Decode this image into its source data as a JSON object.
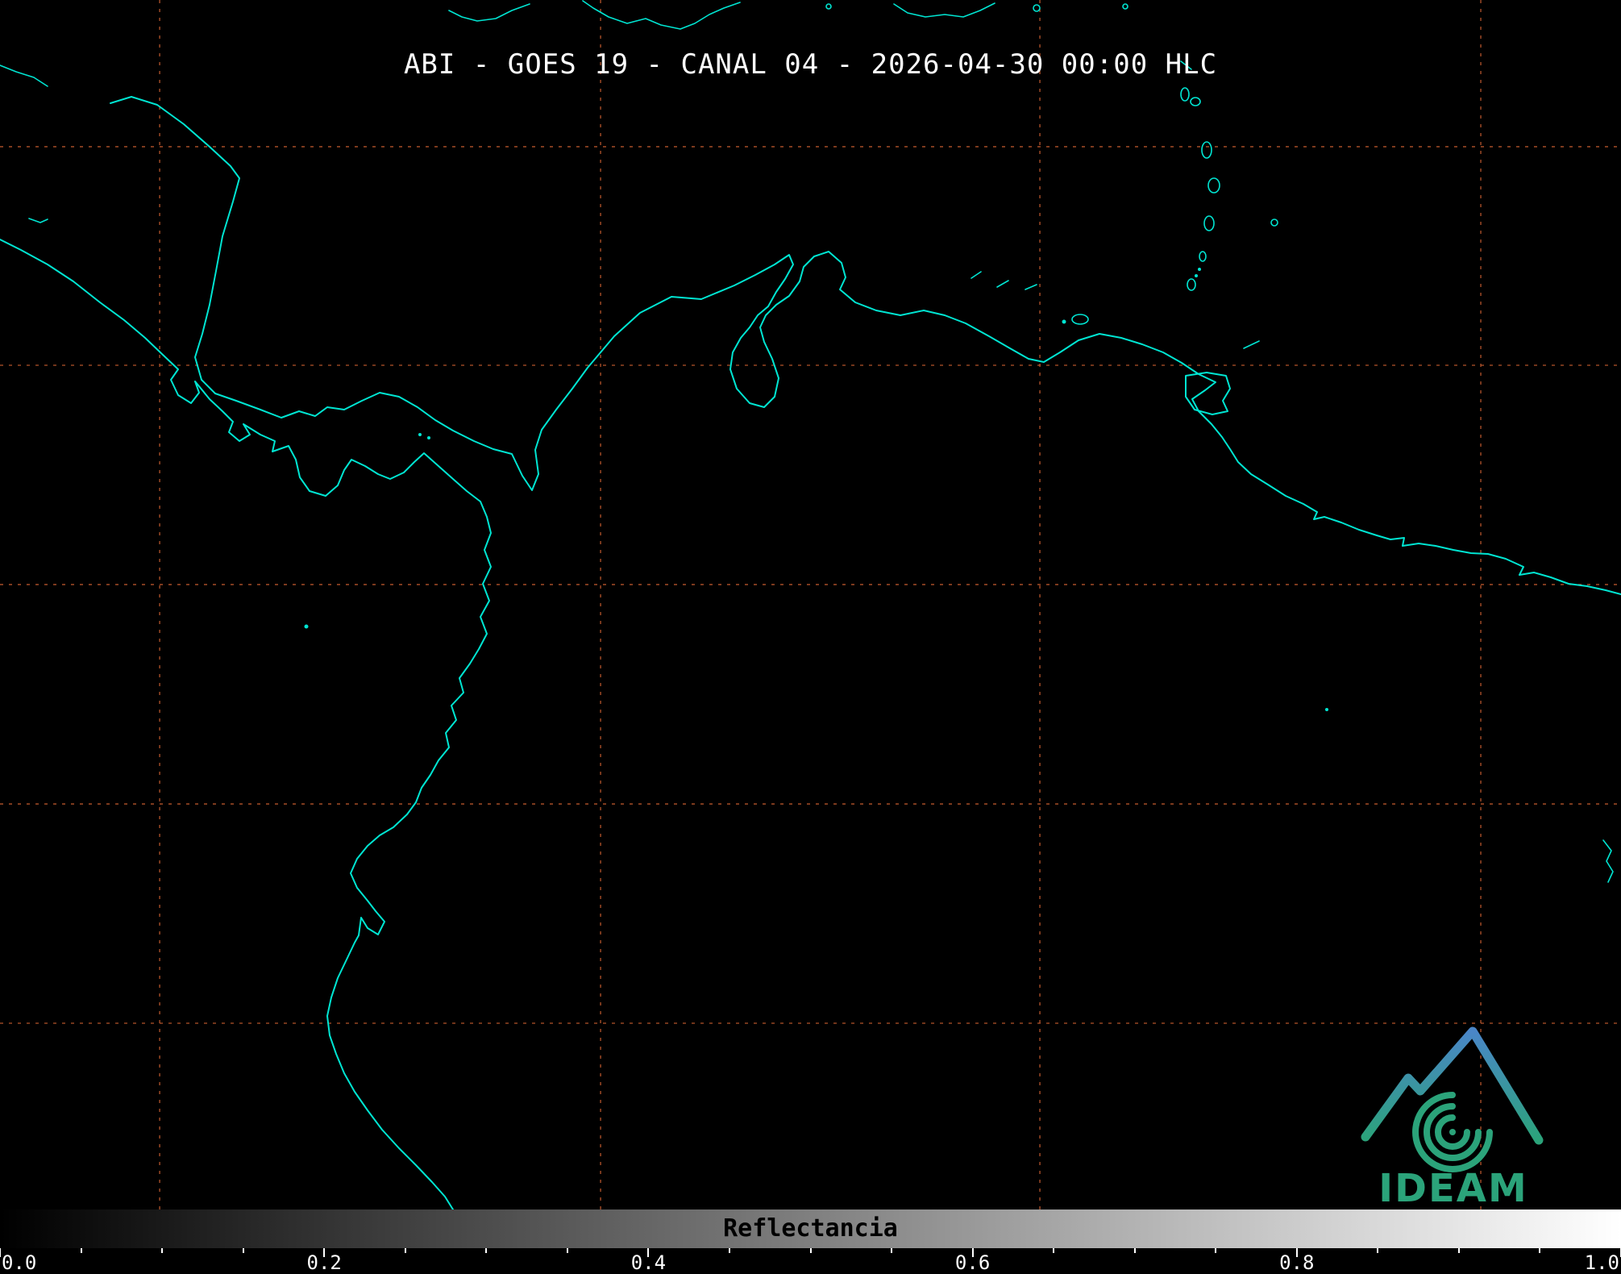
{
  "header": {
    "title": "ABI - GOES 19 - CANAL 04 - 2026-04-30 00:00 HLC"
  },
  "colorbar": {
    "label": "Reflectancia",
    "tick_labels": [
      "0.0",
      "0.2",
      "0.4",
      "0.6",
      "0.8",
      "1.0"
    ],
    "min": 0.0,
    "max": 1.0,
    "gradient_start": "#000000",
    "gradient_end": "#ffffff",
    "minor_tick_step": 0.05,
    "major_tick_every": 4
  },
  "logo": {
    "text": "IDEAM"
  },
  "grid": {
    "vertical_x_fractions": [
      0.0985,
      0.3705,
      0.6415,
      0.9135
    ],
    "horizontal_y_fractions": [
      0.1213,
      0.302,
      0.4833,
      0.6647,
      0.846
    ],
    "dash": "4 7"
  },
  "colors": {
    "background": "#000000",
    "coastline": "#00e5d2",
    "grid": "#b5542b",
    "title": "#ffffff",
    "colorbar_text": "#000000",
    "tick_text": "#ffffff",
    "logo_green": "#2ba37a",
    "logo_blue": "#4a86c8"
  }
}
